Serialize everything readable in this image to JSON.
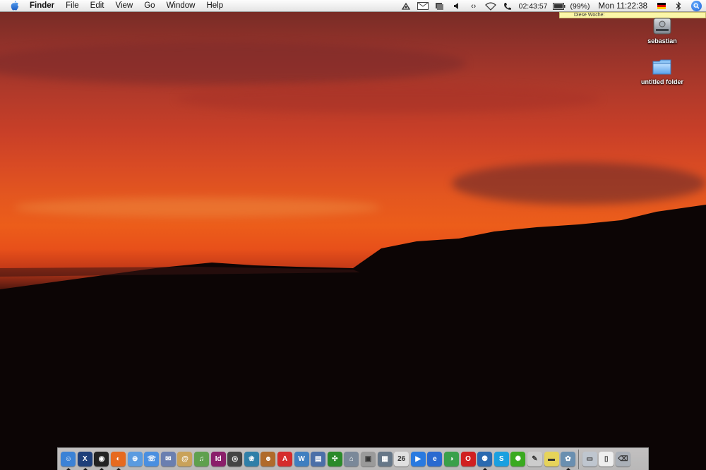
{
  "menubar": {
    "app_name": "Finder",
    "items": [
      "File",
      "Edit",
      "View",
      "Go",
      "Window",
      "Help"
    ],
    "status_time": "02:43:57",
    "battery": "(99%)",
    "clock": "Mon 11:22:38"
  },
  "note_popup": {
    "text": "Diese Woche:"
  },
  "desktop_icons": [
    {
      "label": "sebastian",
      "icon": "hard-drive-icon"
    },
    {
      "label": "untitled folder",
      "icon": "folder-icon"
    }
  ],
  "dock": {
    "apps": [
      {
        "name": "finder-icon",
        "color": "#3b82d6",
        "text": "☺",
        "running": true
      },
      {
        "name": "xcode-icon",
        "color": "#1e3f7a",
        "text": "X",
        "running": true
      },
      {
        "name": "dashboard-icon",
        "color": "#222222",
        "text": "◉",
        "running": true
      },
      {
        "name": "firefox-icon",
        "color": "#e66a1f",
        "text": "◐",
        "running": true
      },
      {
        "name": "safari-icon",
        "color": "#5a9be0",
        "text": "⊕",
        "running": false
      },
      {
        "name": "ichat-icon",
        "color": "#4a8fe0",
        "text": "☏",
        "running": false
      },
      {
        "name": "mail-icon",
        "color": "#6a7fb0",
        "text": "✉",
        "running": false
      },
      {
        "name": "address-book-icon",
        "color": "#c9a25a",
        "text": "@",
        "running": false
      },
      {
        "name": "itunes-icon",
        "color": "#5fa04e",
        "text": "♫",
        "running": false
      },
      {
        "name": "indesign-icon",
        "color": "#8a1f6a",
        "text": "Id",
        "running": false
      },
      {
        "name": "dvd-player-icon",
        "color": "#444444",
        "text": "◎",
        "running": false
      },
      {
        "name": "iphoto-icon",
        "color": "#2f7fa8",
        "text": "❀",
        "running": false
      },
      {
        "name": "photo-booth-icon",
        "color": "#b06a2a",
        "text": "☻",
        "running": false
      },
      {
        "name": "acrobat-icon",
        "color": "#d52c2c",
        "text": "A",
        "running": false
      },
      {
        "name": "unknown-app-icon",
        "color": "#3f7fc0",
        "text": "W",
        "running": false
      },
      {
        "name": "preview-icon",
        "color": "#4b6fa8",
        "text": "▤",
        "running": false
      },
      {
        "name": "tree-app-icon",
        "color": "#2a8a2a",
        "text": "✣",
        "running": false
      },
      {
        "name": "network-icon",
        "color": "#7a8899",
        "text": "⌂",
        "running": false
      },
      {
        "name": "photoshop-icon",
        "color": "#9a9a9a",
        "text": "▣",
        "running": false
      },
      {
        "name": "image-capture-icon",
        "color": "#667788",
        "text": "▦",
        "running": false
      },
      {
        "name": "ical-icon",
        "color": "#e0e0e0",
        "text": "26",
        "running": false
      },
      {
        "name": "quicktime-icon",
        "color": "#2a7ae0",
        "text": "▶",
        "running": false
      },
      {
        "name": "internet-explorer-icon",
        "color": "#2a6ad0",
        "text": "e",
        "running": false
      },
      {
        "name": "camino-icon",
        "color": "#3aa04a",
        "text": "◑",
        "running": false
      },
      {
        "name": "opera-icon",
        "color": "#d02020",
        "text": "O",
        "running": false
      },
      {
        "name": "people-app-icon",
        "color": "#2a6ab0",
        "text": "⚉",
        "running": true
      },
      {
        "name": "skype-icon",
        "color": "#1aa0e0",
        "text": "S",
        "running": false
      },
      {
        "name": "limewire-icon",
        "color": "#3aaa20",
        "text": "✺",
        "running": false
      },
      {
        "name": "textedit-icon",
        "color": "#cccccc",
        "text": "✎",
        "running": false
      },
      {
        "name": "stickies-icon",
        "color": "#e6d35a",
        "text": "▬",
        "running": false
      },
      {
        "name": "photo-app-icon",
        "color": "#6a8fb0",
        "text": "✿",
        "running": true
      }
    ],
    "docs": [
      {
        "name": "screen-sharing-icon",
        "color": "#bfc6cf",
        "text": "▭"
      },
      {
        "name": "document-icon",
        "color": "#eeeeee",
        "text": "▯"
      },
      {
        "name": "trash-icon",
        "color": "#aab0b8",
        "text": "⌫"
      }
    ]
  }
}
